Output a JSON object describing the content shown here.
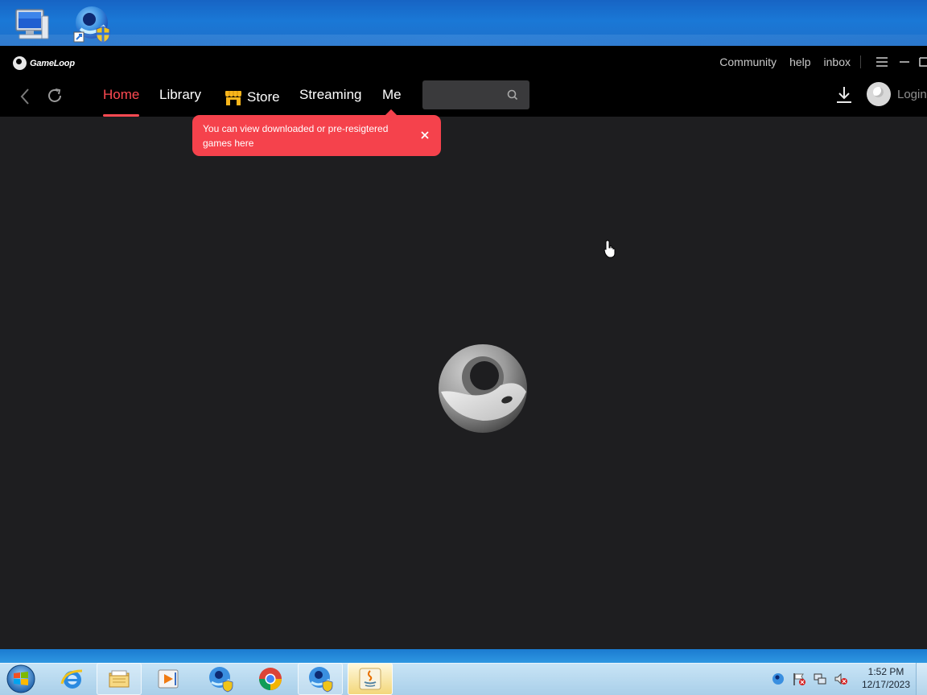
{
  "desktop": {
    "icons": [
      {
        "name": "computer-icon"
      },
      {
        "name": "gameloop-shortcut-icon"
      }
    ]
  },
  "app": {
    "logo_text": "GameLoop",
    "top_links": {
      "community": "Community",
      "help": "help",
      "inbox": "inbox"
    },
    "tabs": {
      "home": "Home",
      "library": "Library",
      "store": "Store",
      "streaming": "Streaming",
      "me": "Me"
    },
    "active_tab": "Home",
    "search": {
      "value": "",
      "placeholder": ""
    },
    "login_label": "Login",
    "tooltip": "You can view downloaded or pre-resigtered games here",
    "accent_color": "#ff4a52"
  },
  "taskbar": {
    "apps": [
      "Internet Explorer",
      "Windows Explorer",
      "Windows Media Player",
      "GameLoop",
      "Google Chrome",
      "GameLoop",
      "Java"
    ],
    "clock": {
      "time": "1:52 PM",
      "date": "12/17/2023"
    }
  }
}
